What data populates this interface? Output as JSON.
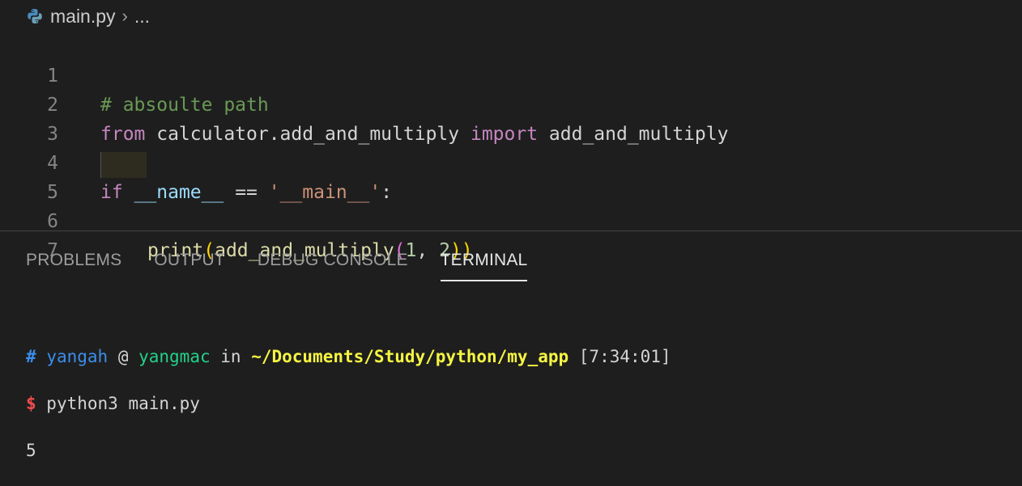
{
  "breadcrumb": {
    "file": "main.py",
    "ellipsis": "..."
  },
  "editor": {
    "lines": [
      {
        "num": "1"
      },
      {
        "num": "2"
      },
      {
        "num": "3"
      },
      {
        "num": "4"
      },
      {
        "num": "5"
      },
      {
        "num": "6"
      },
      {
        "num": "7"
      }
    ],
    "tokens": {
      "l1_comment": "# absoulte path",
      "l2_from": "from",
      "l2_module": " calculator.add_and_multiply ",
      "l2_import": "import",
      "l2_name": " add_and_multiply",
      "l4_if": "if",
      "l4_sp1": " ",
      "l4_name": "__name__",
      "l4_eq": " == ",
      "l4_str": "'__main__'",
      "l4_colon": ":",
      "l5_print": "print",
      "l5_open1": "(",
      "l5_fn": "add_and_multiply",
      "l5_open2": "(",
      "l5_a": "1",
      "l5_comma": ", ",
      "l5_b": "2",
      "l5_close": "))"
    }
  },
  "panel": {
    "tabs": [
      "PROBLEMS",
      "OUTPUT",
      "DEBUG CONSOLE",
      "TERMINAL"
    ],
    "active_tab": "TERMINAL"
  },
  "terminal": {
    "hash": "#",
    "user": "yangah",
    "at": " @ ",
    "host": "yangmac",
    "in": " in ",
    "path": "~/Documents/Study/python/my_app",
    "time": " [7:34:01]",
    "prompt": "$",
    "command": " python3 main.py",
    "output": "5"
  },
  "colors": {
    "background": "#1e1e1e",
    "comment": "#6a9955",
    "keyword": "#c586c0",
    "string": "#ce9178",
    "terminal_path": "#f5f543",
    "terminal_prompt": "#f14c4c"
  }
}
